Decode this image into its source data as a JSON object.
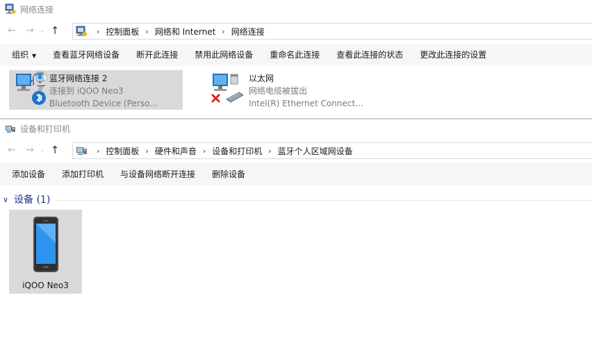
{
  "window1": {
    "title": "网络连接",
    "nav": {
      "back": "←",
      "forward": "→",
      "recent": "⌄",
      "up": "↑"
    },
    "breadcrumb": [
      "控制面板",
      "网络和 Internet",
      "网络连接"
    ],
    "crumb_sep": "›",
    "toolbar": {
      "organize": "组织",
      "organize_caret": "▼",
      "items": [
        "查看蓝牙网络设备",
        "断开此连接",
        "禁用此网络设备",
        "重命名此连接",
        "查看此连接的状态",
        "更改此连接的设置"
      ]
    },
    "connections": [
      {
        "name": "蓝牙网络连接 2",
        "status": "连接到 iQOO Neo3",
        "device": "Bluetooth Device (Perso...",
        "icon": "bluetooth-network-icon",
        "selected": true
      },
      {
        "name": "以太网",
        "status": "网络电缆被拔出",
        "device": "Intel(R) Ethernet Connect...",
        "icon": "ethernet-network-icon",
        "selected": false
      }
    ]
  },
  "window2": {
    "title": "设备和打印机",
    "nav": {
      "back": "←",
      "forward": "→",
      "recent": "⌄",
      "up": "↑"
    },
    "breadcrumb": [
      "控制面板",
      "硬件和声音",
      "设备和打印机",
      "蓝牙个人区域网设备"
    ],
    "crumb_sep": "›",
    "toolbar": {
      "items": [
        "添加设备",
        "添加打印机",
        "与设备网络断开连接",
        "删除设备"
      ]
    },
    "group": {
      "label": "设备 (1)",
      "chevron": "∨"
    },
    "devices": [
      {
        "name": "iQOO Neo3",
        "icon": "phone-icon"
      }
    ]
  },
  "colors": {
    "toolbar_bg": "#f5f6f7",
    "selection_bg": "#d9d9d9",
    "group_label": "#1e3287",
    "muted_text": "#7a7a7a"
  }
}
